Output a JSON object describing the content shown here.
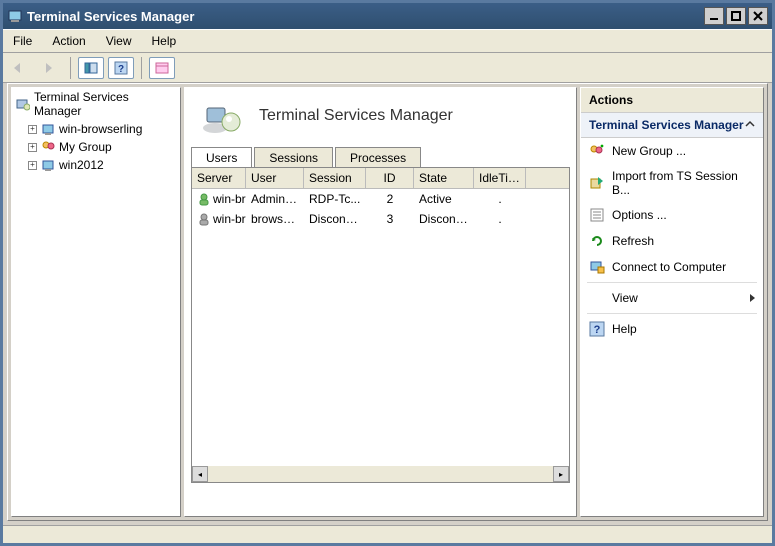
{
  "window": {
    "title": "Terminal Services Manager"
  },
  "menu": {
    "file": "File",
    "action": "Action",
    "view": "View",
    "help": "Help"
  },
  "tree": {
    "root": "Terminal Services Manager",
    "items": [
      {
        "label": "win-browserling"
      },
      {
        "label": "My Group"
      },
      {
        "label": "win2012"
      }
    ]
  },
  "center": {
    "title": "Terminal Services Manager",
    "tabs": {
      "users": "Users",
      "sessions": "Sessions",
      "processes": "Processes"
    },
    "columns": {
      "server": "Server",
      "user": "User",
      "session": "Session",
      "id": "ID",
      "state": "State",
      "idle": "IdleTime"
    },
    "rows": [
      {
        "server": "win-br...",
        "user": "Administ...",
        "session": "RDP-Tc...",
        "id": "2",
        "state": "Active",
        "idle": "."
      },
      {
        "server": "win-br...",
        "user": "browserl...",
        "session": "Disconn...",
        "id": "3",
        "state": "Disconn...",
        "idle": "."
      }
    ]
  },
  "actions": {
    "header": "Actions",
    "subheader": "Terminal Services Manager",
    "items": {
      "new_group": "New Group ...",
      "import": "Import from TS Session B...",
      "options": "Options ...",
      "refresh": "Refresh",
      "connect": "Connect to Computer",
      "view": "View",
      "help": "Help"
    }
  }
}
